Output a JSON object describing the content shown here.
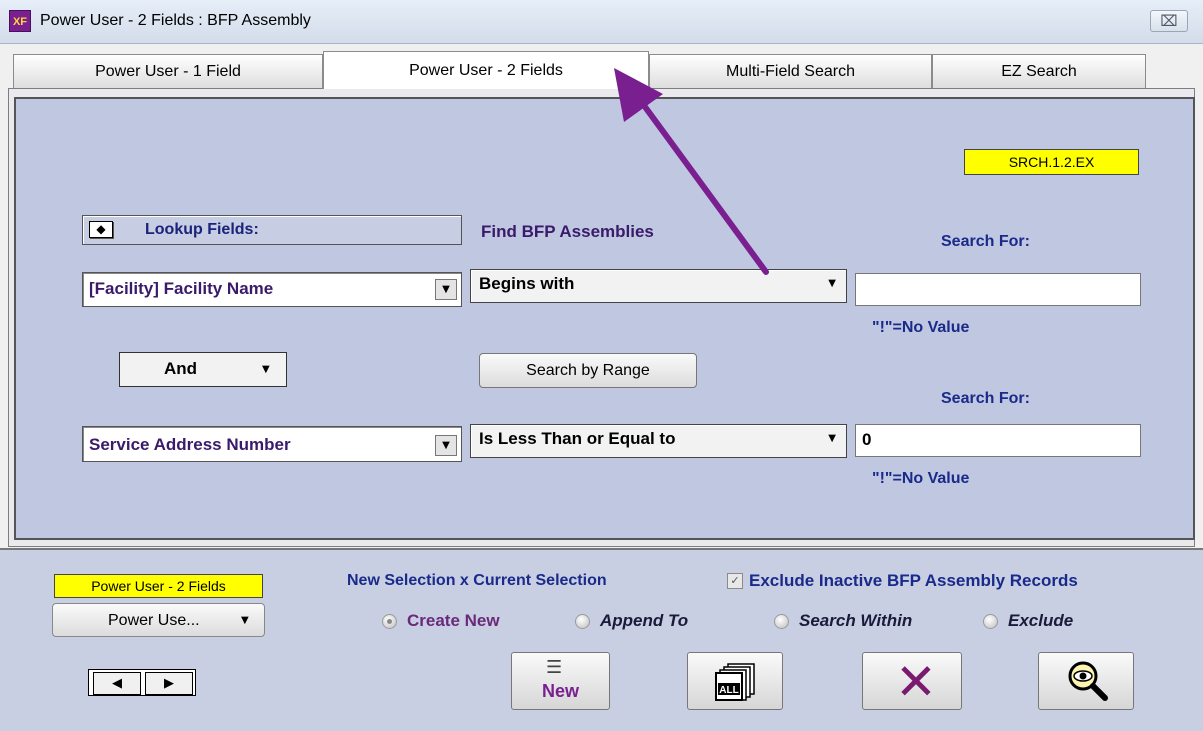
{
  "window": {
    "icon_text": "XF",
    "title": "Power User - 2 Fields : BFP Assembly",
    "close_glyph": "⌧"
  },
  "tabs": [
    {
      "label": "Power User - 1 Field",
      "active": false
    },
    {
      "label": "Power User - 2 Fields",
      "active": true
    },
    {
      "label": "Multi-Field Search",
      "active": false
    },
    {
      "label": "EZ Search",
      "active": false
    }
  ],
  "main": {
    "code": "SRCH.1.2.EX",
    "lookup_button_glyph": "◆",
    "lookup_label": "Lookup Fields:",
    "find_label": "Find BFP Assemblies",
    "search_for_1": "Search For:",
    "search_for_2": "Search For:",
    "row1": {
      "field": "[Facility] Facility Name",
      "operator": "Begins with",
      "value": "",
      "no_value_hint": "\"!\"=No Value"
    },
    "conjunction": "And",
    "range_button": "Search by Range",
    "row2": {
      "field": "Service Address Number",
      "operator": "Is Less Than or Equal to",
      "value": "0",
      "no_value_hint": "\"!\"=No Value"
    }
  },
  "bottom": {
    "mode_label": "Power User - 2 Fields",
    "mode_popup": "Power Use...",
    "nav_prev": "◀",
    "nav_next": "▶",
    "selection_label": "New Selection x Current Selection",
    "exclude_inactive": {
      "label": "Exclude Inactive BFP Assembly Records",
      "checked": true
    },
    "radios": [
      {
        "label": "Create New",
        "selected": true
      },
      {
        "label": "Append To",
        "selected": false
      },
      {
        "label": "Search Within",
        "selected": false
      },
      {
        "label": "Exclude",
        "selected": false
      }
    ],
    "buttons": {
      "new_label": "New",
      "new_icon": "list-new-icon",
      "all_icon": "all-records-icon",
      "cancel_icon": "close-x-icon",
      "search_icon": "magnifier-eye-icon"
    }
  },
  "annotation": {
    "arrow_color": "#7a1f8f"
  },
  "colors": {
    "panel": "#c0c7e1",
    "label_blue": "#1a2a8a",
    "field_purple": "#3a1a6a",
    "highlight": "#ffff00"
  }
}
